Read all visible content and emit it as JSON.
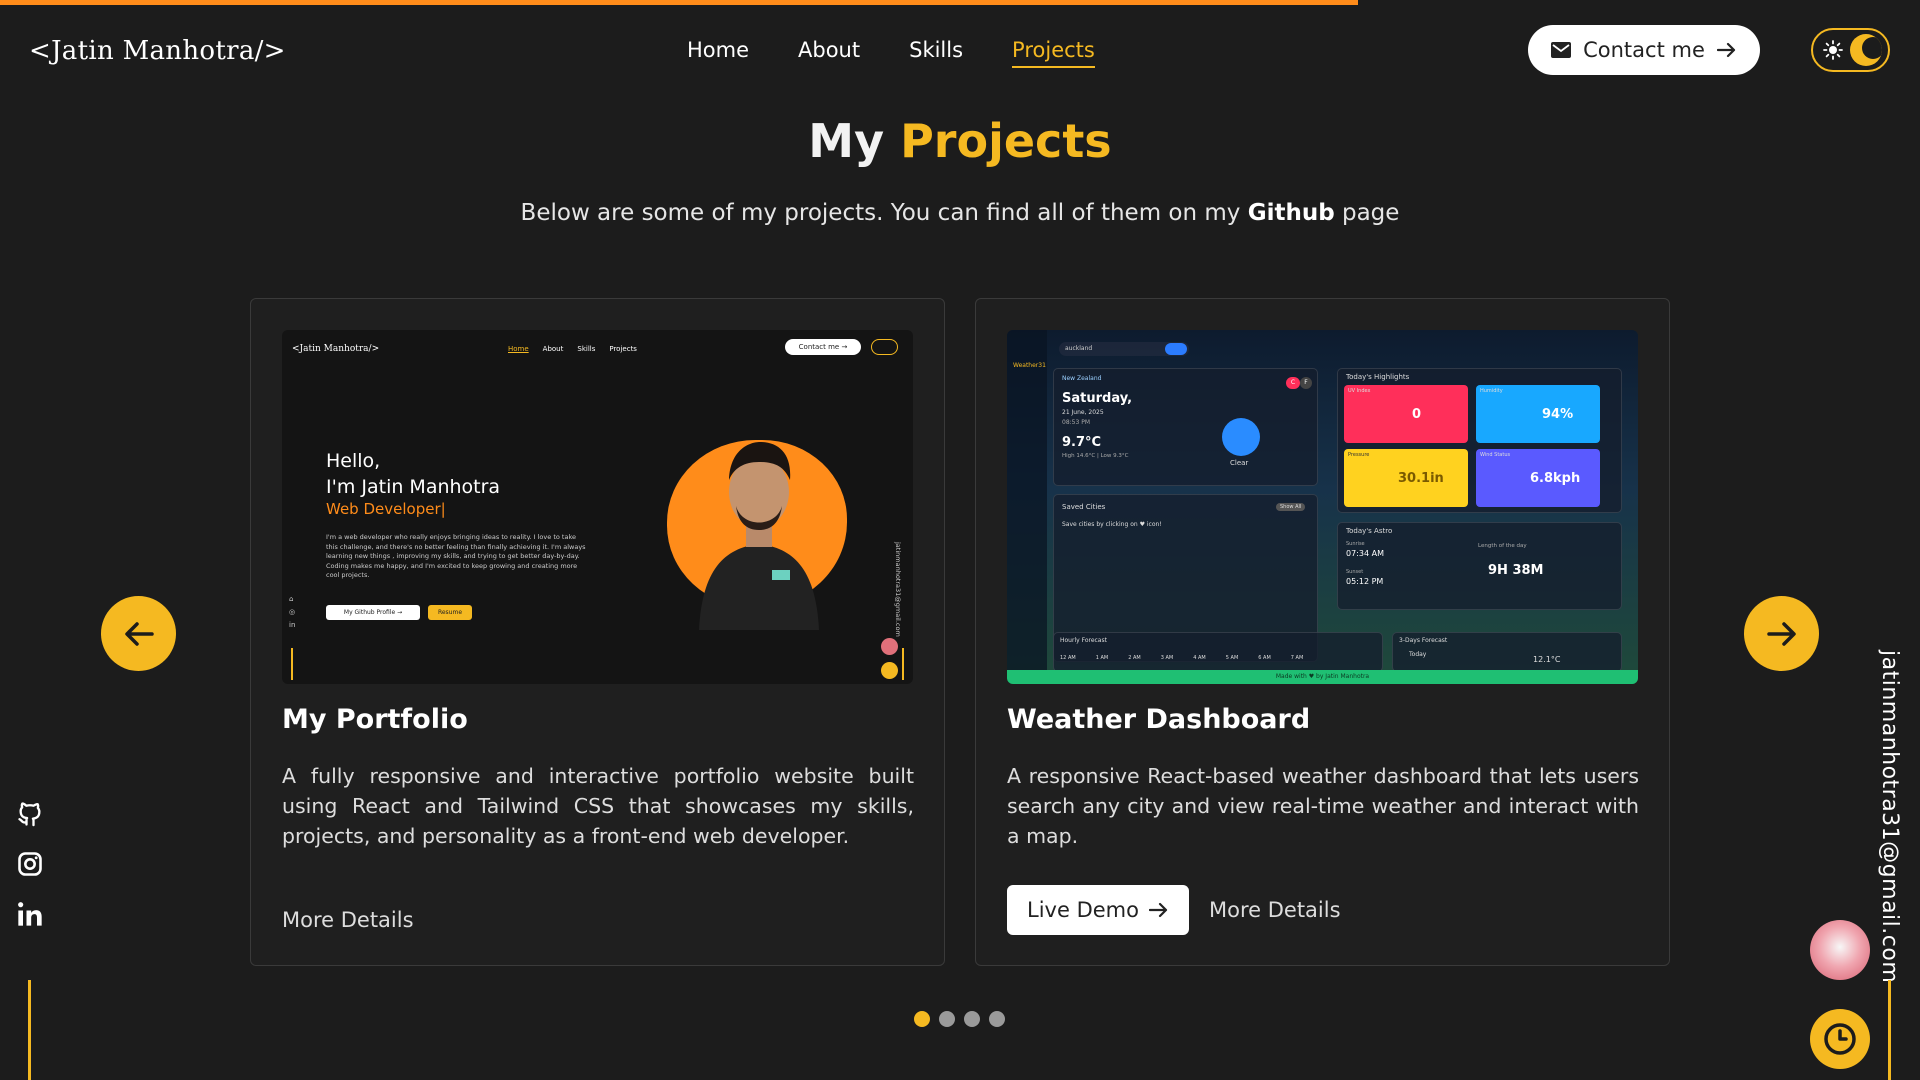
{
  "header": {
    "logo": "<Jatin Manhotra/>",
    "nav": [
      {
        "label": "Home"
      },
      {
        "label": "About"
      },
      {
        "label": "Skills"
      },
      {
        "label": "Projects"
      }
    ],
    "active_nav": "Projects",
    "contact_label": "Contact me"
  },
  "hero": {
    "title_plain": "My",
    "title_accent": "Projects",
    "subtitle_before": "Below are some of my projects. You can find all of them on my",
    "subtitle_bold": "Github",
    "subtitle_after": "page"
  },
  "projects": [
    {
      "title": "My Portfolio",
      "description": "A fully responsive and interactive portfolio website built using React and Tailwind CSS that showcases my skills, projects, and personality as a front-end web developer.",
      "more_label": "More Details",
      "preview": {
        "logo": "<Jatin Manhotra/>",
        "nav": [
          "Home",
          "About",
          "Skills",
          "Projects"
        ],
        "contact": "Contact me →",
        "hello": "Hello,",
        "name": "I'm Jatin Manhotra",
        "role": "Web Developer|",
        "bio": "I'm a web developer who really enjoys bringing ideas to reality. I love to take this challenge, and there's no better feeling than finally achieving it. I'm always learning new things , improving my skills, and trying to get better day-by-day. Coding makes me happy, and I'm excited to keep growing and creating more cool projects.",
        "btn_github": "My Github Profile →",
        "btn_resume": "Resume",
        "email": "jatinmanhotra31@gmail.com"
      }
    },
    {
      "title": "Weather Dashboard",
      "description": "A responsive React-based weather dashboard that lets users search any city and view real-time weather and interact with a map.",
      "live_label": "Live Demo",
      "more_label": "More Details",
      "preview": {
        "app_name": "Weather31",
        "search_value": "auckland",
        "country": "New Zealand",
        "day": "Saturday,",
        "date": "21 June, 2025",
        "time": "08:53 PM",
        "temp": "9.7°C",
        "hi_lo": "High 14.6°C | Low 9.3°C",
        "condition": "Clear",
        "units": [
          "C",
          "F"
        ],
        "saved_title": "Saved Cities",
        "saved_show": "Show All",
        "saved_hint": "Save cities by clicking on ♥ icon!",
        "highlights_title": "Today's Highlights",
        "highlights": [
          {
            "label": "UV Index",
            "value": "0",
            "color": "#ff2f5a"
          },
          {
            "label": "Humidity",
            "value": "94%",
            "color": "#18a8ff"
          },
          {
            "label": "Pressure",
            "value": "30.1in",
            "color": "#ffd21f"
          },
          {
            "label": "Wind Status",
            "value": "6.8kph",
            "color": "#5a5aff"
          }
        ],
        "astro_title": "Today's Astro",
        "sunrise_label": "Sunrise",
        "sunrise": "07:34 AM",
        "sunset_label": "Sunset",
        "sunset": "05:12 PM",
        "length_label": "Length of the day",
        "length": "9H 38M",
        "hourly_title": "Hourly Forecast",
        "hours": [
          "12 AM",
          "1 AM",
          "2 AM",
          "3 AM",
          "4 AM",
          "5 AM",
          "6 AM",
          "7 AM"
        ],
        "days_title": "3-Days Forecast",
        "days_today": "Today",
        "days_temp": "12.1°C",
        "footer": "Made with ♥ by Jatin Manhotra"
      }
    }
  ],
  "carousel": {
    "dot_count": 4,
    "active_index": 0
  },
  "side": {
    "email": "jatinmanhotra31@gmail.com"
  },
  "colors": {
    "accent": "#f5b921",
    "orange": "#ff8c1a",
    "background": "#1c1c1c"
  },
  "icons": {
    "social": [
      "github-icon",
      "instagram-icon",
      "linkedin-icon"
    ]
  }
}
